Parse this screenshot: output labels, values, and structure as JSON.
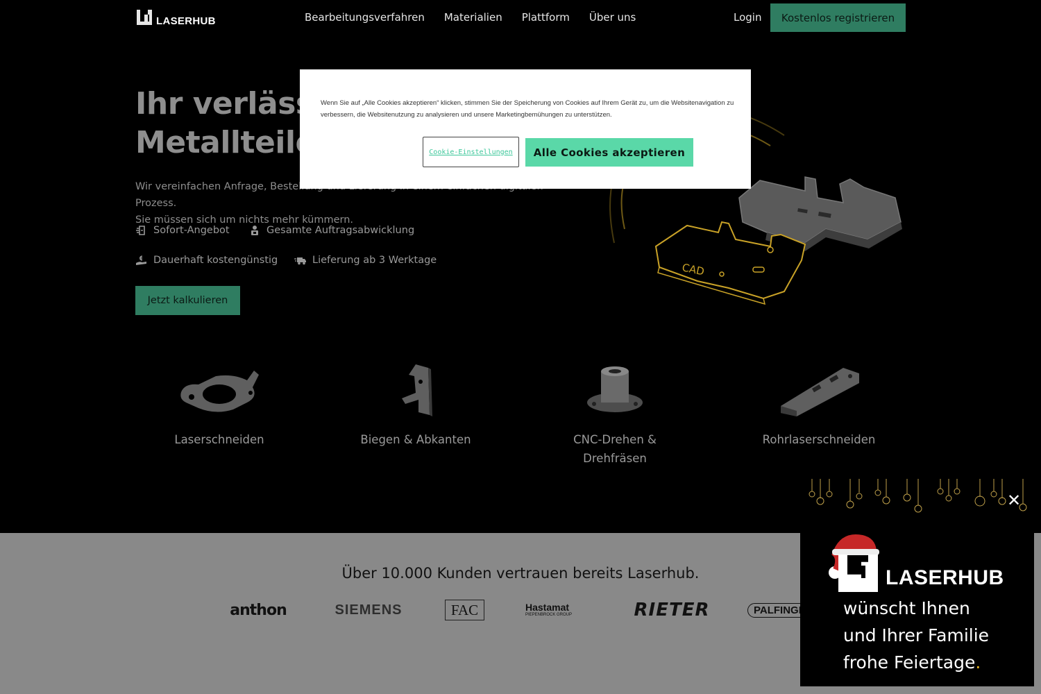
{
  "header": {
    "logo_text": "LASERHUB",
    "nav": [
      "Bearbeitungsverfahren",
      "Materialien",
      "Plattform",
      "Über uns"
    ],
    "login_label": "Login",
    "register_label": "Kostenlos registrieren"
  },
  "hero": {
    "title_line1": "Ihr verlässl",
    "title_line2": "Metallteile",
    "subtitle_line1": "Wir vereinfachen Anfrage, Bestellung und Lieferung in einem einfachen digitalen Prozess.",
    "subtitle_line2": "Sie müssen sich um nichts mehr kümmern.",
    "features": [
      {
        "label": "Sofort-Angebot",
        "icon": "instant-quote-icon"
      },
      {
        "label": "Gesamte Auftragsabwicklung",
        "icon": "order-handling-icon"
      },
      {
        "label": "Dauerhaft kostengünstig",
        "icon": "cost-hand-icon"
      },
      {
        "label": "Lieferung ab 3 Werktage",
        "icon": "delivery-truck-icon"
      }
    ],
    "cta_label": "Jetzt kalkulieren",
    "art_label": "CAD"
  },
  "services": [
    {
      "label": "Laserschneiden"
    },
    {
      "label": "Biegen & Abkanten"
    },
    {
      "label_line1": "CNC-Drehen &",
      "label_line2": "Drehfräsen"
    },
    {
      "label": "Rohrlaserschneiden"
    }
  ],
  "trust": {
    "title": "Über 10.000 Kunden vertrauen bereits Laserhub.",
    "logos": [
      "anthon",
      "SIEMENS",
      "FAC",
      "Hastamat",
      "PIEPENBROCK GROUP",
      "RIETER",
      "PALFINGER"
    ]
  },
  "cookie": {
    "text": "Wenn Sie auf „Alle Cookies akzeptieren“ klicken, stimmen Sie der Speicherung von Cookies auf Ihrem Gerät zu, um die Websitenavigation zu verbessern, die Websitenutzung zu analysieren und unsere Marketingbemühungen zu unterstützen.",
    "settings_label": "Cookie-Einstellungen",
    "accept_label": "Alle Cookies akzeptieren"
  },
  "holiday": {
    "brand": "LASERHUB",
    "message_line1": "wünscht Ihnen",
    "message_line2": "und Ihrer Familie",
    "message_line3": "frohe Feiertage",
    "message_end": ".",
    "close_label": "✕"
  },
  "colors": {
    "accent_green": "#2f7d61",
    "cookie_accept": "#5ad8a8",
    "art_gold": "#c9a227",
    "trust_bg": "#898989"
  }
}
